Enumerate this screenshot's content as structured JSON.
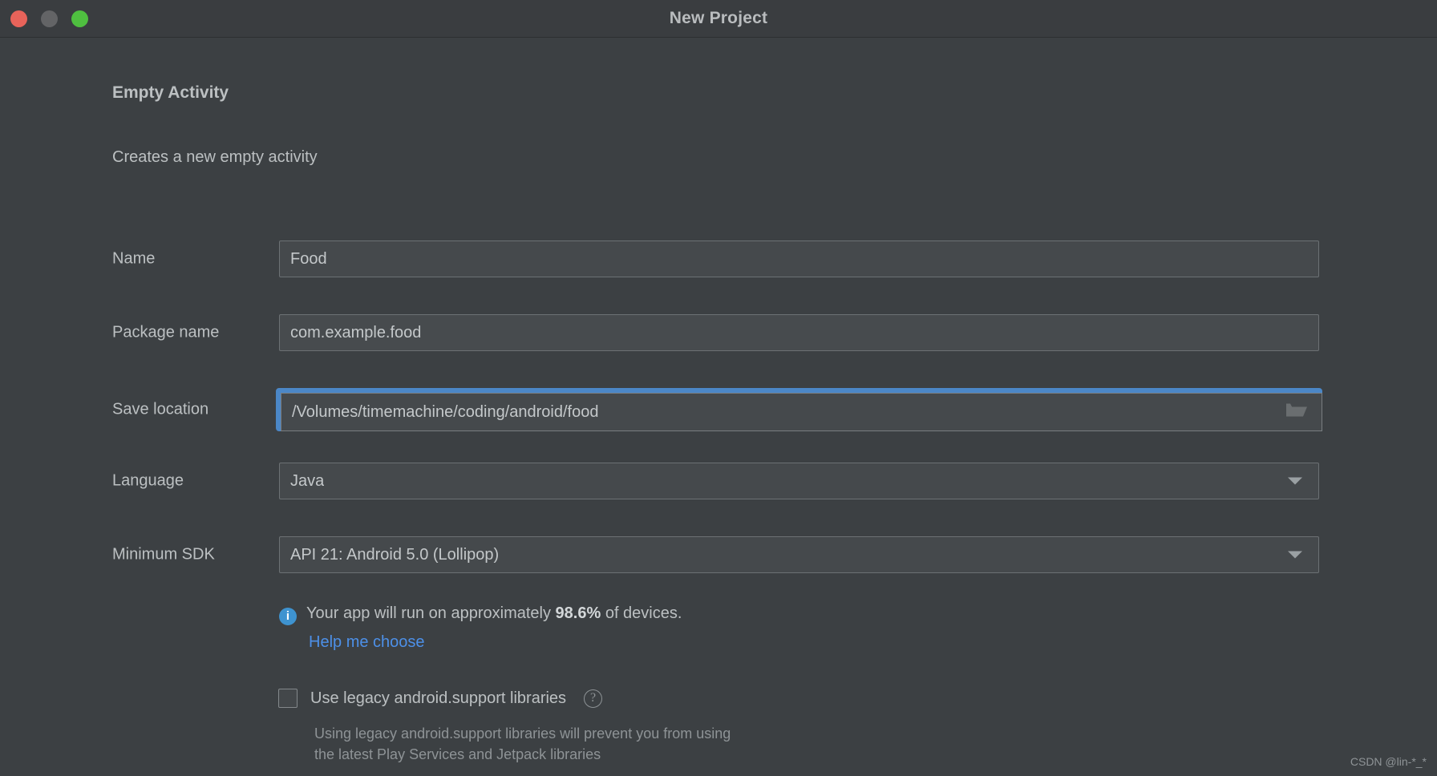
{
  "window": {
    "title": "New Project",
    "traffic_lights": [
      {
        "name": "close",
        "color": "#e8635a"
      },
      {
        "name": "minimize",
        "color": "#636466"
      },
      {
        "name": "zoom",
        "color": "#4fbf40"
      }
    ]
  },
  "template": {
    "heading": "Empty Activity",
    "description": "Creates a new empty activity"
  },
  "form": {
    "rows": [
      {
        "label": "Name",
        "value": "Food"
      },
      {
        "label": "Package name",
        "value": "com.example.food"
      },
      {
        "label": "Save location",
        "value": "/Volumes/timemachine/coding/android/food"
      },
      {
        "label": "Language",
        "value": "Java"
      },
      {
        "label": "Minimum SDK",
        "value": "API 21: Android 5.0 (Lollipop)"
      }
    ]
  },
  "sdk_info": {
    "text_before": "Your app will run on approximately ",
    "percent": "98.6%",
    "text_after": " of devices.",
    "help_link": "Help me choose",
    "icon": "info-icon"
  },
  "legacy": {
    "label": "Use legacy android.support libraries",
    "checked": false,
    "help_icon": "?",
    "hint_line1": "Using legacy android.support libraries will prevent you from using",
    "hint_line2": "the latest Play Services and Jetpack libraries"
  },
  "watermark": "CSDN @lin-*_*",
  "colors": {
    "window_bg": "#3c4043",
    "titlebar_bg": "#3a3d40",
    "field_bg": "#45494c",
    "field_border": "#6c7174",
    "focus_ring": "#4b87c7",
    "text": "#bcc0c2",
    "link": "#4d90e8",
    "info_blue": "#3e93d0"
  }
}
